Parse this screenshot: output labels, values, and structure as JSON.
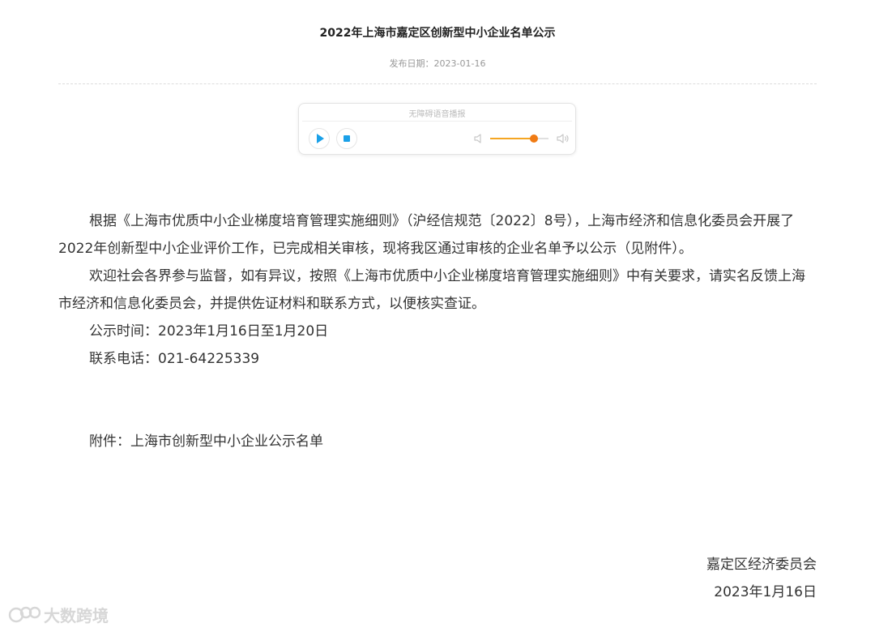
{
  "article": {
    "title": "2022年上海市嘉定区创新型中小企业名单公示",
    "date_label": "发布日期：2023-01-16"
  },
  "player": {
    "label": "无障碍语音播报",
    "volume": 0.75,
    "icons": {
      "play": "play-icon",
      "stop": "stop-icon",
      "vol_low": "volume-low-icon",
      "vol_high": "volume-high-icon"
    },
    "accent_color": "#1aa0e8",
    "slider_color": "#f07b14"
  },
  "body": {
    "para1": "根据《上海市优质中小企业梯度培育管理实施细则》（沪经信规范〔2022〕8号），上海市经济和信息化委员会开展了2022年创新型中小企业评价工作，已完成相关审核，现将我区通过审核的企业名单予以公示（见附件）。",
    "para2": "欢迎社会各界参与监督，如有异议，按照《上海市优质中小企业梯度培育管理实施细则》中有关要求，请实名反馈上海市经济和信息化委员会，并提供佐证材料和联系方式，以便核实查证。",
    "publicity_time": "公示时间：2023年1月16日至1月20日",
    "phone": "联系电话：021-64225339",
    "attachment": "附件：上海市创新型中小企业公示名单"
  },
  "signature": {
    "org": "嘉定区经济委员会",
    "date": "2023年1月16日"
  },
  "watermark": {
    "text": "大数跨境",
    "icon": "logo-icon"
  }
}
